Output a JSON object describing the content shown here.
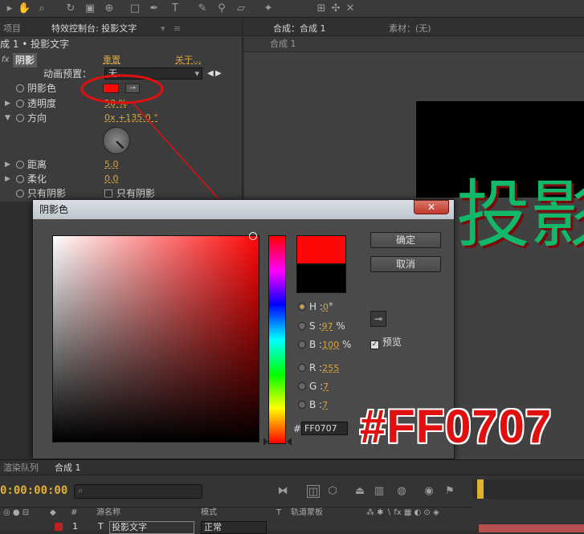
{
  "left_panel": {
    "tab_project": "项目",
    "tab_effect_controls": "特效控制台: 投影文字",
    "layer_path": "成 1 • 投影文字",
    "effect_name": "阴影",
    "reset_label": "重置",
    "about_label": "关于...",
    "preset_label": "动画预置：",
    "preset_value": "无",
    "properties": [
      {
        "label": "阴影色",
        "value": ""
      },
      {
        "label": "透明度",
        "value": "50 %"
      },
      {
        "label": "方向",
        "value": "0x +135.0 °"
      },
      {
        "label": "距离",
        "value": "5.0"
      },
      {
        "label": "柔化",
        "value": "0.0"
      },
      {
        "label": "只有阴影",
        "value": "只有阴影"
      }
    ],
    "shadow_color_hex": "#FF0707"
  },
  "right_panel": {
    "tab_comp": "合成：合成 1",
    "tab_footage": "素材：(无)",
    "breadcrumb": "合成 1",
    "preview_text": "投影"
  },
  "dialog": {
    "title": "阴影色",
    "ok_label": "确定",
    "cancel_label": "取消",
    "preview_label": "预览",
    "hex_prefix": "#",
    "hex_value": "FF0707",
    "fields": [
      {
        "key": "H",
        "value": "0",
        "unit": "°",
        "selected": true
      },
      {
        "key": "S",
        "value": "97",
        "unit": "%",
        "selected": false
      },
      {
        "key": "B",
        "value": "100",
        "unit": "%",
        "selected": false
      },
      {
        "key": "R",
        "value": "255",
        "unit": "",
        "selected": false
      },
      {
        "key": "G",
        "value": "7",
        "unit": "",
        "selected": false
      },
      {
        "key": "B",
        "value": "7",
        "unit": "",
        "selected": false
      }
    ],
    "new_color": "#FF0707",
    "old_color": "#000000"
  },
  "bottom_panel": {
    "tab_render_queue": "渲染队列",
    "tab_comp": "合成 1",
    "timecode": "0:00:00:00",
    "col_source": "源名称",
    "col_mode": "模式",
    "col_t": "T",
    "col_trkmat": "轨道蒙板",
    "col_hash": "#",
    "layer_num": "1",
    "layer_name": "投影文字",
    "layer_mode": "正常"
  },
  "annotation": {
    "hex_callout": "#FF0707"
  }
}
